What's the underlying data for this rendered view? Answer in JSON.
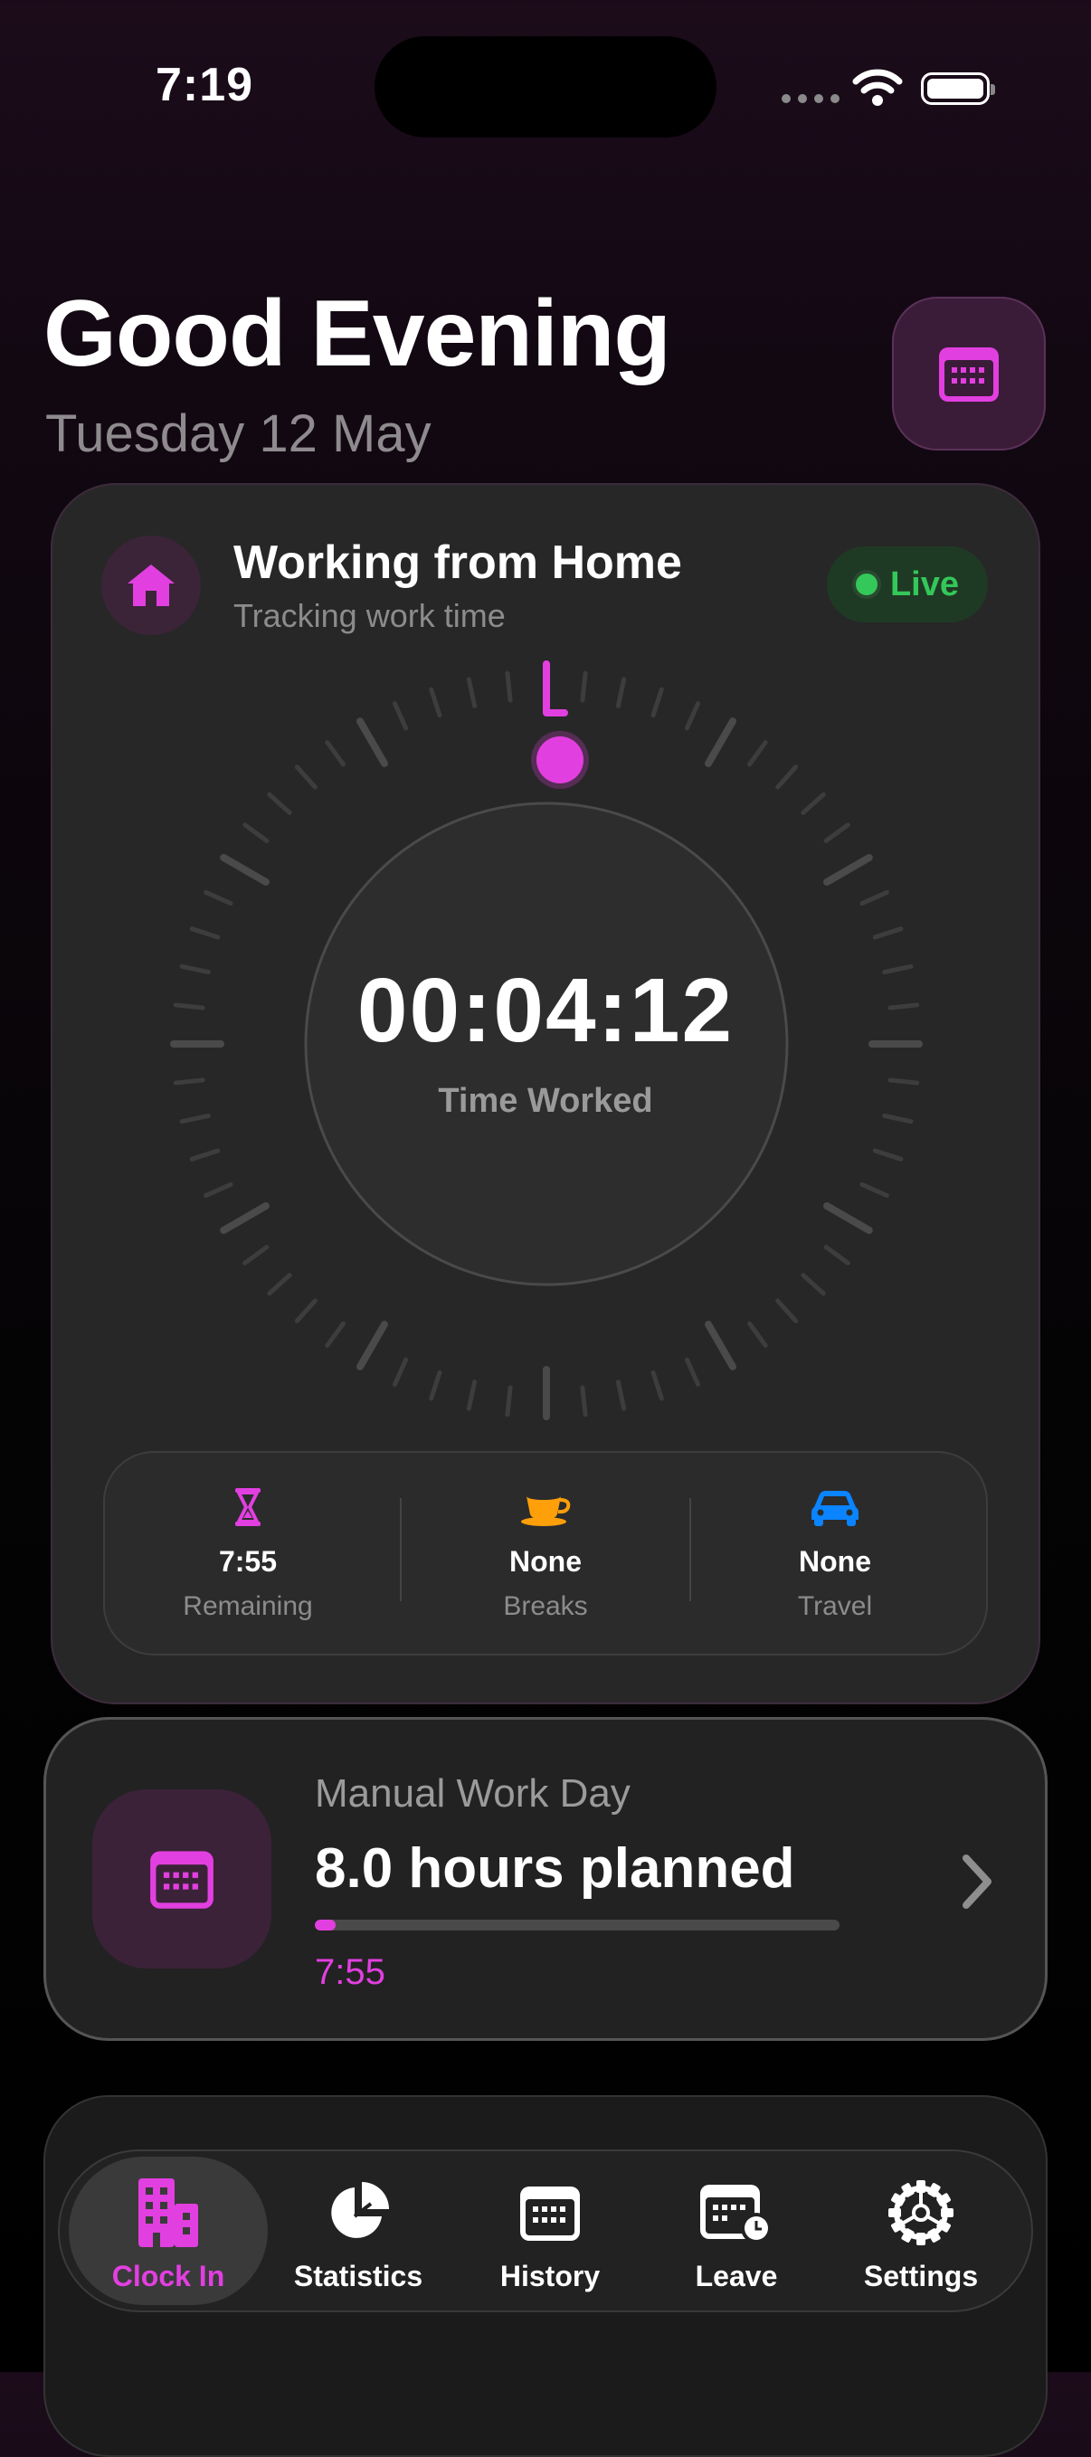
{
  "status_bar": {
    "time": "7:19"
  },
  "header": {
    "greeting": "Good Evening",
    "date": "Tuesday 12 May"
  },
  "work_card": {
    "title": "Working from Home",
    "subtitle": "Tracking work time",
    "status_badge": "Live",
    "elapsed": "00:04:12",
    "elapsed_label": "Time Worked",
    "stats": [
      {
        "icon": "hourglass-icon",
        "value": "7:55",
        "label": "Remaining"
      },
      {
        "icon": "coffee-cup-icon",
        "value": "None",
        "label": "Breaks"
      },
      {
        "icon": "car-icon",
        "value": "None",
        "label": "Travel"
      }
    ]
  },
  "manual_card": {
    "title": "Manual Work Day",
    "hours": "8.0 hours planned",
    "remaining": "7:55",
    "progress": 0.04
  },
  "tabs": [
    {
      "label": "Clock In",
      "icon": "building-icon",
      "active": true
    },
    {
      "label": "Statistics",
      "icon": "pie-chart-icon",
      "active": false
    },
    {
      "label": "History",
      "icon": "calendar-icon",
      "active": false
    },
    {
      "label": "Leave",
      "icon": "calendar-clock-icon",
      "active": false
    },
    {
      "label": "Settings",
      "icon": "gear-icon",
      "active": false
    }
  ],
  "colors": {
    "accent": "#e23fe0",
    "live_green": "#34c759",
    "coffee_orange": "#ff9f0a",
    "car_blue": "#0a84ff"
  }
}
